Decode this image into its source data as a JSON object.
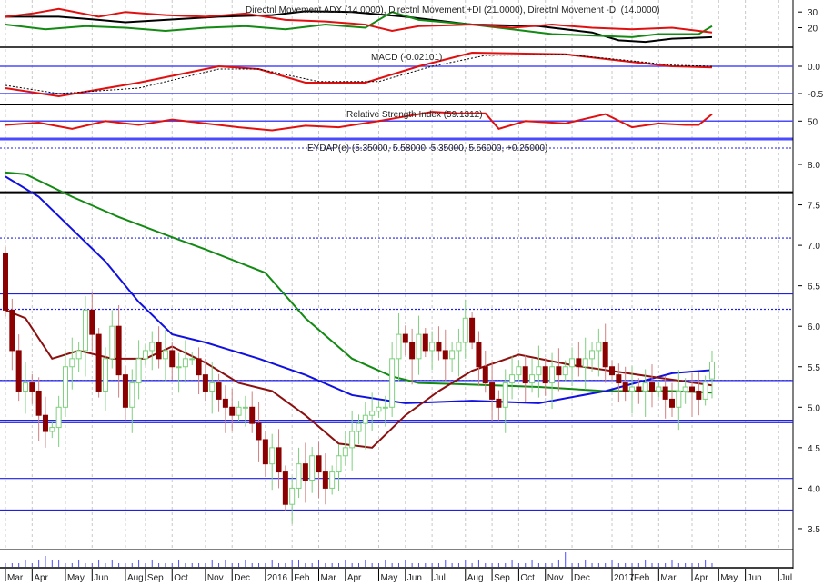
{
  "chart_data": {
    "type": "candlestick",
    "symbol_label": "EYDAP(e) (5.35000, 5.58000, 5.35000, 5.56000, +0.25000)",
    "colors": {
      "up": "#1a9a1a",
      "down": "#8b0000",
      "ma_long": "#138a13",
      "ma_mid": "#1010e0",
      "ma_short": "#8b1010",
      "hline": "#2020e0",
      "resist": "#000000"
    },
    "x_labels": [
      "Mar",
      "Apr",
      "May",
      "Jun",
      "Aug",
      "Sep",
      "Oct",
      "Nov",
      "Dec",
      "2016",
      "Feb",
      "Mar",
      "Apr",
      "May",
      "Jun",
      "Jul",
      "Aug",
      "Sep",
      "Oct",
      "Nov",
      "Dec",
      "2017",
      "Feb",
      "Mar",
      "Apr",
      "May",
      "Jun",
      "Jul"
    ],
    "x_label_weeks": [
      0,
      4,
      9,
      13,
      18,
      21,
      25,
      30,
      34,
      39,
      43,
      47,
      51,
      56,
      60,
      64,
      69,
      73,
      77,
      81,
      85,
      91,
      94,
      98,
      103,
      107,
      111,
      116
    ],
    "price_axis": {
      "ticks": [
        "8.0",
        "7.5",
        "7.0",
        "6.5",
        "6.0",
        "5.5",
        "5.0",
        "4.5",
        "4.0",
        "3.5"
      ],
      "range": [
        3.4,
        8.2
      ]
    },
    "horizontal_lines": [
      {
        "value": 7.65,
        "style": "thick"
      },
      {
        "value": 7.09,
        "style": "dotted"
      },
      {
        "value": 6.4,
        "style": "solid"
      },
      {
        "value": 6.21,
        "style": "dotted"
      },
      {
        "value": 5.33,
        "style": "dotted"
      },
      {
        "value": 5.33,
        "style": "solid"
      },
      {
        "value": 4.84,
        "style": "solid"
      },
      {
        "value": 4.81,
        "style": "solid"
      },
      {
        "value": 4.12,
        "style": "solid"
      },
      {
        "value": 3.73,
        "style": "solid"
      }
    ],
    "closes": [
      6.2,
      5.7,
      5.2,
      5.3,
      5.2,
      4.9,
      4.7,
      4.75,
      5.0,
      5.5,
      5.6,
      5.7,
      6.2,
      5.9,
      5.2,
      5.6,
      6.0,
      5.4,
      5.0,
      5.3,
      5.6,
      5.7,
      5.8,
      5.6,
      5.7,
      5.5,
      5.5,
      5.6,
      5.6,
      5.4,
      5.2,
      5.3,
      5.1,
      5.0,
      4.9,
      5.0,
      5.0,
      4.8,
      4.6,
      4.3,
      4.5,
      4.2,
      3.8,
      4.0,
      4.3,
      4.1,
      4.4,
      4.2,
      4.0,
      4.2,
      4.4,
      4.5,
      4.7,
      4.8,
      4.9,
      4.95,
      5.0,
      5.0,
      5.6,
      5.9,
      5.8,
      5.6,
      5.9,
      5.7,
      5.8,
      5.7,
      5.6,
      5.7,
      5.8,
      6.1,
      5.8,
      5.5,
      5.3,
      5.1,
      5.0,
      5.3,
      5.4,
      5.5,
      5.3,
      5.4,
      5.5,
      5.3,
      5.5,
      5.4,
      5.5,
      5.6,
      5.5,
      5.6,
      5.7,
      5.8,
      5.5,
      5.4,
      5.3,
      5.2,
      5.25,
      5.2,
      5.3,
      5.2,
      5.25,
      5.1,
      5.0,
      5.2,
      5.25,
      5.2,
      5.1,
      5.31,
      5.56
    ],
    "first_open": 6.9,
    "ma_long": [
      [
        0,
        7.9
      ],
      [
        3,
        7.88
      ],
      [
        10,
        7.6
      ],
      [
        17,
        7.35
      ],
      [
        25,
        7.1
      ],
      [
        30,
        6.95
      ],
      [
        39,
        6.66
      ],
      [
        45,
        6.1
      ],
      [
        52,
        5.6
      ],
      [
        58,
        5.38
      ],
      [
        62,
        5.3
      ],
      [
        70,
        5.28
      ],
      [
        80,
        5.25
      ],
      [
        90,
        5.2
      ],
      [
        100,
        5.2
      ],
      [
        106,
        5.18
      ]
    ],
    "ma_mid": [
      [
        0,
        7.85
      ],
      [
        5,
        7.6
      ],
      [
        10,
        7.2
      ],
      [
        15,
        6.8
      ],
      [
        20,
        6.3
      ],
      [
        25,
        5.9
      ],
      [
        30,
        5.8
      ],
      [
        38,
        5.6
      ],
      [
        45,
        5.4
      ],
      [
        52,
        5.15
      ],
      [
        60,
        5.05
      ],
      [
        70,
        5.08
      ],
      [
        80,
        5.05
      ],
      [
        90,
        5.2
      ],
      [
        100,
        5.42
      ],
      [
        106,
        5.46
      ]
    ],
    "ma_short": [
      [
        0,
        6.2
      ],
      [
        3,
        6.1
      ],
      [
        7,
        5.6
      ],
      [
        11,
        5.7
      ],
      [
        16,
        5.6
      ],
      [
        21,
        5.6
      ],
      [
        25,
        5.75
      ],
      [
        30,
        5.55
      ],
      [
        35,
        5.3
      ],
      [
        40,
        5.2
      ],
      [
        45,
        4.9
      ],
      [
        50,
        4.55
      ],
      [
        55,
        4.5
      ],
      [
        60,
        4.9
      ],
      [
        65,
        5.2
      ],
      [
        70,
        5.45
      ],
      [
        77,
        5.65
      ],
      [
        85,
        5.52
      ],
      [
        95,
        5.4
      ],
      [
        106,
        5.27
      ]
    ],
    "volume": [
      1,
      1,
      1,
      2,
      1,
      2,
      3,
      2,
      2,
      1,
      1,
      2,
      1,
      1,
      2,
      1,
      2,
      1,
      1,
      1,
      2,
      1,
      2,
      1,
      1,
      1,
      2,
      1,
      1,
      1,
      1,
      2,
      1,
      2,
      1,
      1,
      2,
      1,
      1,
      1,
      2,
      1,
      1,
      2,
      2,
      1,
      1,
      2,
      1,
      1,
      1,
      2,
      1,
      1,
      2,
      1,
      1,
      2,
      1,
      1,
      2,
      1,
      1,
      1,
      1,
      1,
      2,
      1,
      1,
      2,
      1,
      2,
      1,
      1,
      1,
      1,
      2,
      1,
      1,
      2,
      1,
      1,
      1,
      2,
      4,
      1,
      1,
      2,
      1,
      1,
      1,
      2,
      1,
      1,
      1,
      1,
      2,
      1,
      1,
      1,
      2,
      1,
      1,
      1,
      1,
      2,
      1
    ],
    "indicators": [
      {
        "name": "dmi",
        "title": "Directnl Movement ADX (14.0000), Directnl Movement +DI (21.0000), Directnl Movement -DI (14.0000)",
        "ticks": [
          "30",
          "20"
        ],
        "tick_values": [
          30,
          20
        ],
        "range": [
          7.6,
          33
        ],
        "series": [
          {
            "name": "ADX",
            "color": "#000000",
            "points": [
              [
                0,
                27
              ],
              [
                8,
                27
              ],
              [
                14,
                25
              ],
              [
                18,
                23.5
              ],
              [
                24,
                25
              ],
              [
                32,
                27
              ],
              [
                40,
                28
              ],
              [
                45,
                30.5
              ],
              [
                52,
                30
              ],
              [
                60,
                27
              ],
              [
                70,
                22
              ],
              [
                80,
                21
              ],
              [
                88,
                17
              ],
              [
                92,
                12
              ],
              [
                96,
                11
              ],
              [
                100,
                13
              ],
              [
                106,
                14
              ]
            ]
          },
          {
            "name": "+DI",
            "color": "#138a13",
            "points": [
              [
                0,
                22
              ],
              [
                6,
                19
              ],
              [
                12,
                21
              ],
              [
                18,
                20
              ],
              [
                24,
                18
              ],
              [
                30,
                20
              ],
              [
                36,
                21
              ],
              [
                42,
                19
              ],
              [
                48,
                22
              ],
              [
                54,
                20
              ],
              [
                58,
                30
              ],
              [
                62,
                25
              ],
              [
                70,
                22
              ],
              [
                76,
                19
              ],
              [
                82,
                16
              ],
              [
                88,
                15
              ],
              [
                94,
                14
              ],
              [
                98,
                16
              ],
              [
                104,
                16
              ],
              [
                106,
                21
              ]
            ]
          },
          {
            "name": "-DI",
            "color": "#e01010",
            "points": [
              [
                0,
                27
              ],
              [
                4,
                29
              ],
              [
                8,
                32
              ],
              [
                14,
                27
              ],
              [
                18,
                30
              ],
              [
                24,
                28
              ],
              [
                30,
                27
              ],
              [
                36,
                29
              ],
              [
                42,
                25
              ],
              [
                48,
                24
              ],
              [
                54,
                22
              ],
              [
                58,
                18
              ],
              [
                62,
                21
              ],
              [
                70,
                22
              ],
              [
                76,
                20
              ],
              [
                82,
                22
              ],
              [
                88,
                20
              ],
              [
                94,
                19
              ],
              [
                100,
                20
              ],
              [
                106,
                17
              ]
            ]
          }
        ]
      },
      {
        "name": "macd",
        "title": "MACD (-0.02101)",
        "ticks": [
          "0.0",
          "-0.5"
        ],
        "tick_values": [
          0,
          -0.5
        ],
        "range": [
          -0.7,
          0.3
        ],
        "series": [
          {
            "name": "MACD",
            "color": "#e01010",
            "points": [
              [
                0,
                -0.4
              ],
              [
                8,
                -0.55
              ],
              [
                20,
                -0.3
              ],
              [
                32,
                0
              ],
              [
                38,
                -0.05
              ],
              [
                45,
                -0.3
              ],
              [
                54,
                -0.3
              ],
              [
                62,
                0
              ],
              [
                70,
                0.25
              ],
              [
                84,
                0.22
              ],
              [
                94,
                0.08
              ],
              [
                100,
                0
              ],
              [
                106,
                -0.02
              ]
            ]
          },
          {
            "name": "Signal",
            "color": "#000000",
            "dash": true,
            "points": [
              [
                0,
                -0.35
              ],
              [
                8,
                -0.5
              ],
              [
                20,
                -0.4
              ],
              [
                32,
                -0.05
              ],
              [
                38,
                -0.05
              ],
              [
                47,
                -0.28
              ],
              [
                56,
                -0.28
              ],
              [
                64,
                0
              ],
              [
                72,
                0.2
              ],
              [
                84,
                0.22
              ],
              [
                94,
                0.1
              ],
              [
                100,
                0.02
              ],
              [
                106,
                0
              ]
            ]
          }
        ]
      },
      {
        "name": "rsi",
        "title": "Relative Strength Index (59.1312)",
        "ticks": [
          "50"
        ],
        "tick_values": [
          50
        ],
        "range": [
          28,
          68
        ],
        "series": [
          {
            "name": "RSI",
            "color": "#e01010",
            "points": [
              [
                0,
                45
              ],
              [
                5,
                48
              ],
              [
                10,
                40
              ],
              [
                15,
                50
              ],
              [
                20,
                45
              ],
              [
                25,
                52
              ],
              [
                30,
                47
              ],
              [
                35,
                42
              ],
              [
                40,
                38
              ],
              [
                45,
                44
              ],
              [
                50,
                42
              ],
              [
                56,
                50
              ],
              [
                60,
                56
              ],
              [
                64,
                62
              ],
              [
                68,
                60
              ],
              [
                72,
                60
              ],
              [
                74,
                40
              ],
              [
                78,
                50
              ],
              [
                84,
                47
              ],
              [
                90,
                59
              ],
              [
                94,
                42
              ],
              [
                98,
                47
              ],
              [
                102,
                45
              ],
              [
                104,
                45
              ],
              [
                106,
                59
              ]
            ]
          }
        ]
      }
    ]
  }
}
